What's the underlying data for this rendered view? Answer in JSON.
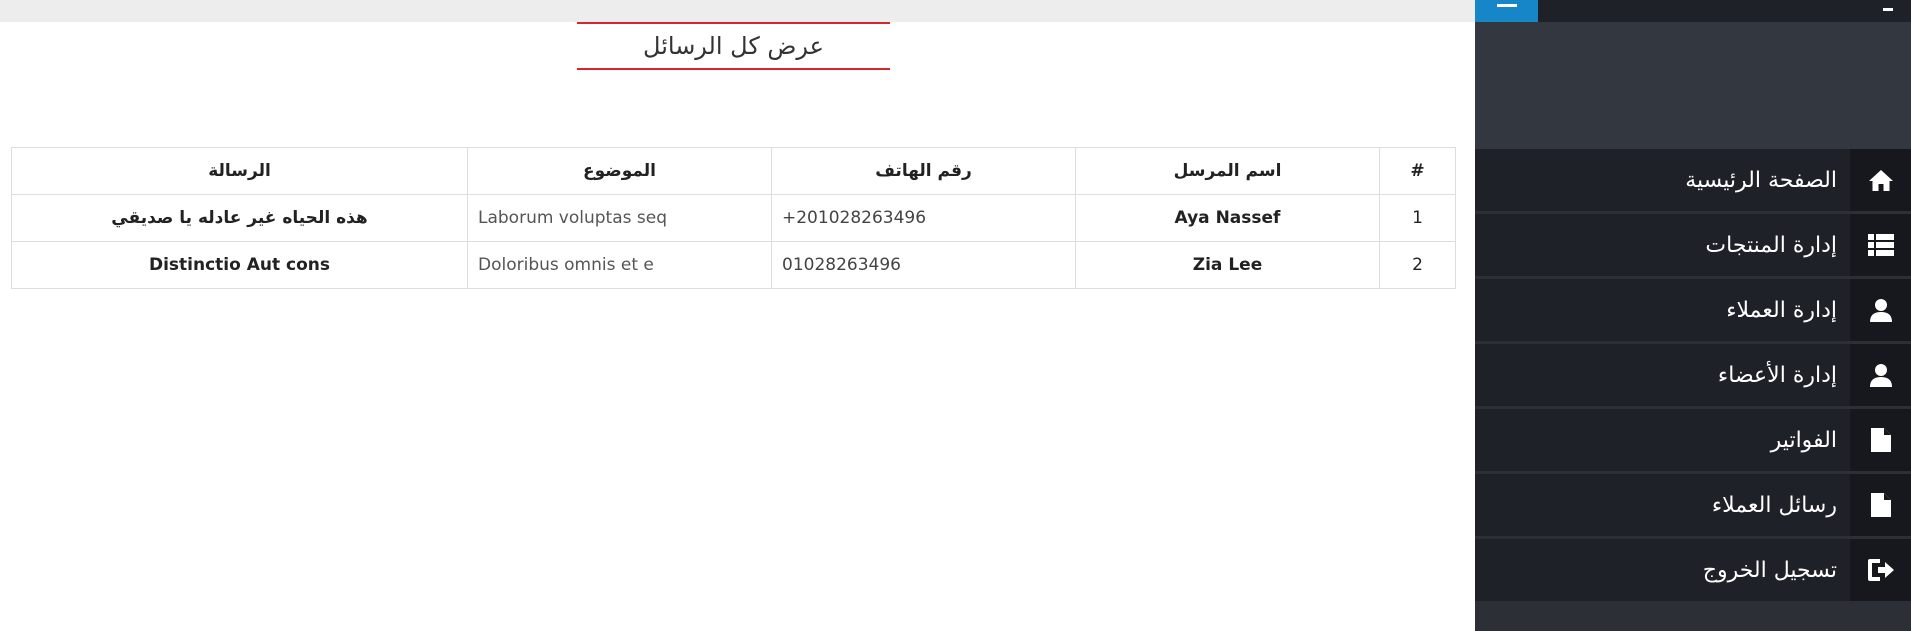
{
  "page": {
    "title": "عرض كل الرسائل"
  },
  "table": {
    "headers": [
      "#",
      "اسم المرسل",
      "رقم الهاتف",
      "الموضوع",
      "الرسالة"
    ],
    "rows": [
      {
        "num": "1",
        "name": "Aya Nassef",
        "phone": "+201028263496",
        "subject": "Laborum voluptas seq",
        "message": "هذه الحياه غير عادله يا صديقي"
      },
      {
        "num": "2",
        "name": "Zia Lee",
        "phone": "01028263496",
        "subject": "Doloribus omnis et e",
        "message": "Distinctio Aut cons"
      }
    ]
  },
  "sidebar": {
    "items": [
      {
        "label": "الصفحة الرئيسية",
        "icon": "home-icon"
      },
      {
        "label": "إدارة المنتجات",
        "icon": "list-icon"
      },
      {
        "label": "إدارة العملاء",
        "icon": "user-icon"
      },
      {
        "label": "إدارة الأعضاء",
        "icon": "user-icon"
      },
      {
        "label": "الفواتير",
        "icon": "file-icon"
      },
      {
        "label": "رسائل العملاء",
        "icon": "file-icon"
      },
      {
        "label": "تسجيل الخروج",
        "icon": "logout-icon"
      }
    ]
  },
  "colors": {
    "accent_red": "#d9232d",
    "sidebar_bg": "#2c2f36",
    "menu_bg": "#1e2127",
    "toggle_blue": "#1786c8"
  }
}
